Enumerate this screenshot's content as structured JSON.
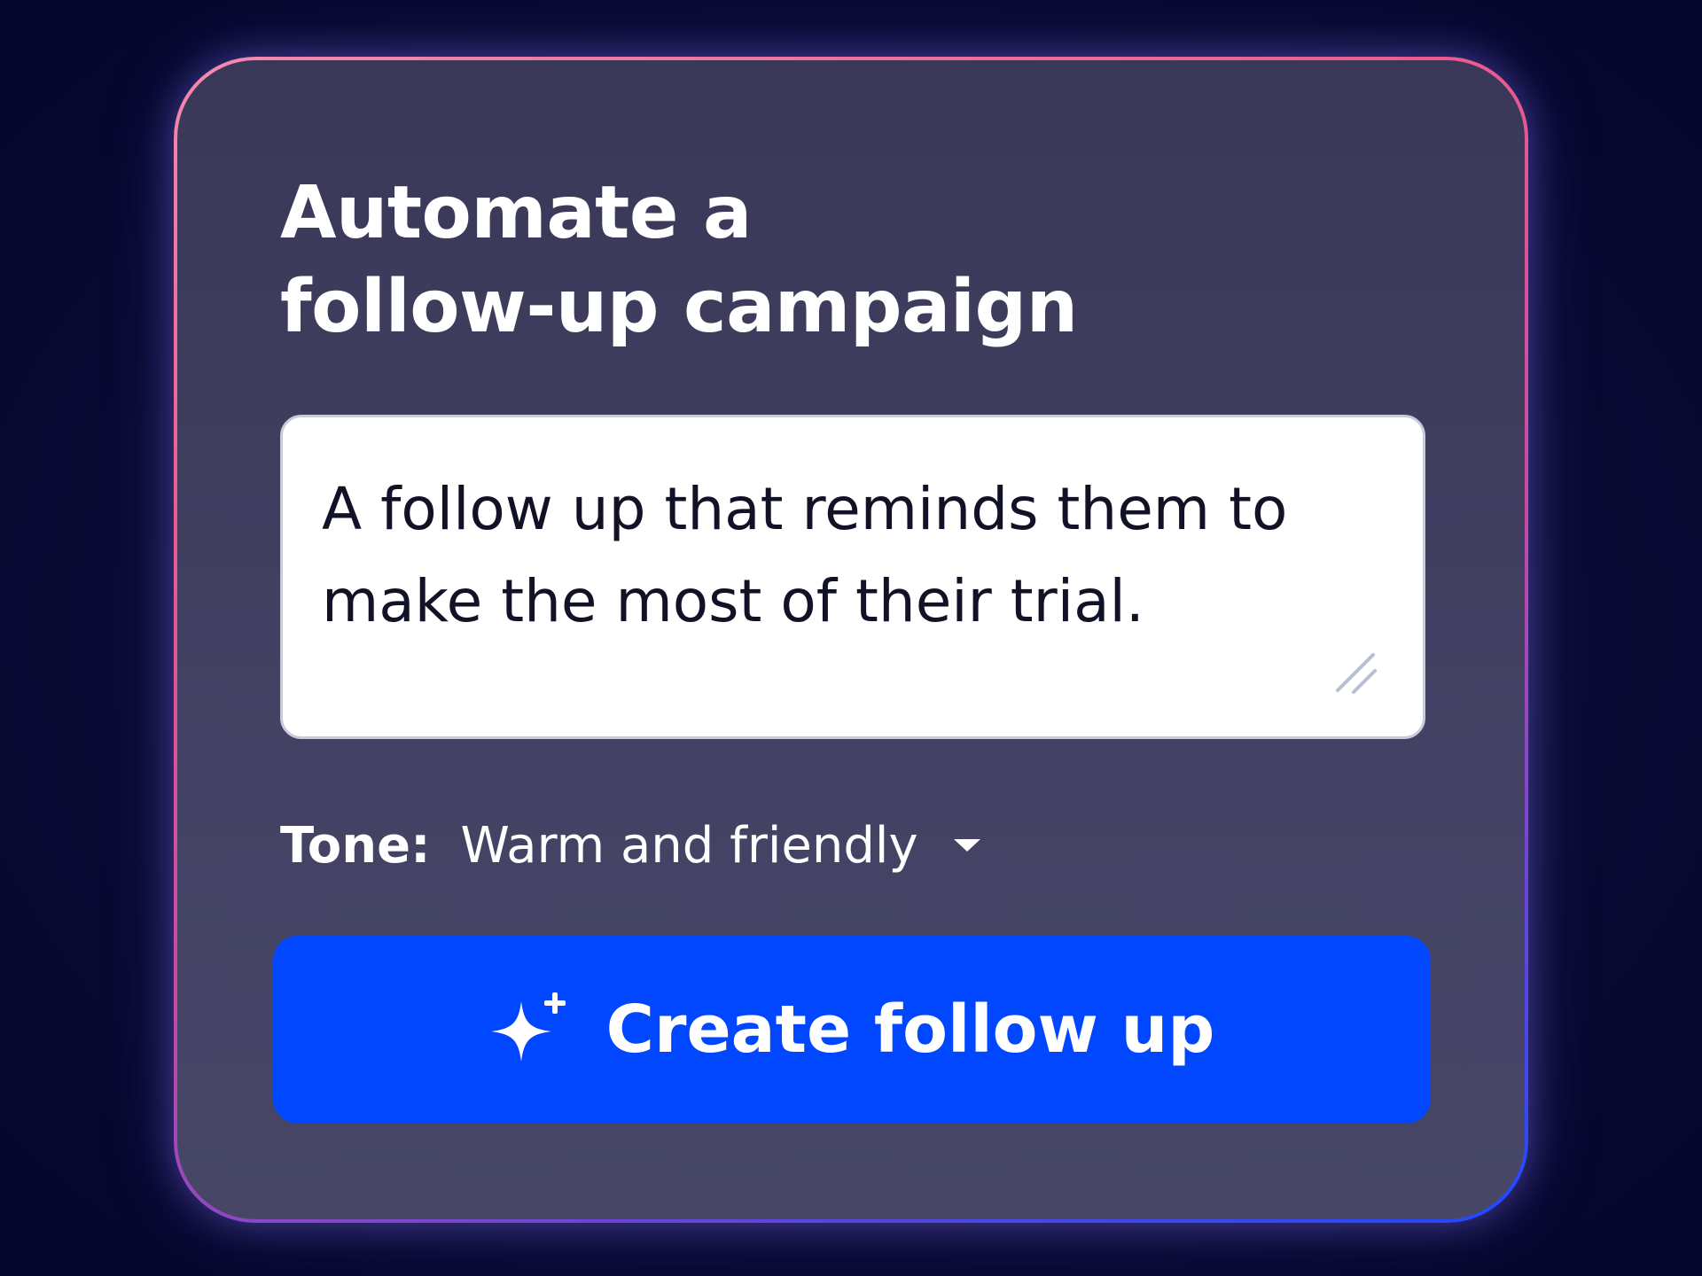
{
  "card": {
    "title_line1": "Automate a",
    "title_line2": "follow-up campaign",
    "prompt": {
      "value": "A follow up that reminds them to make the most of their trial."
    },
    "tone": {
      "label": "Tone:",
      "selected": "Warm and friendly",
      "icon": "chevron-down-icon"
    },
    "create_button": {
      "label": "Create follow up",
      "icon": "sparkle-icon"
    }
  },
  "colors": {
    "background": "#05072e",
    "card": "#3f3e5e",
    "border_gradient": [
      "#f28bb0",
      "#ec5b8f",
      "#c34aa6",
      "#6a45d8",
      "#1f49ff"
    ],
    "button": "#0047ff",
    "text": "#ffffff"
  }
}
